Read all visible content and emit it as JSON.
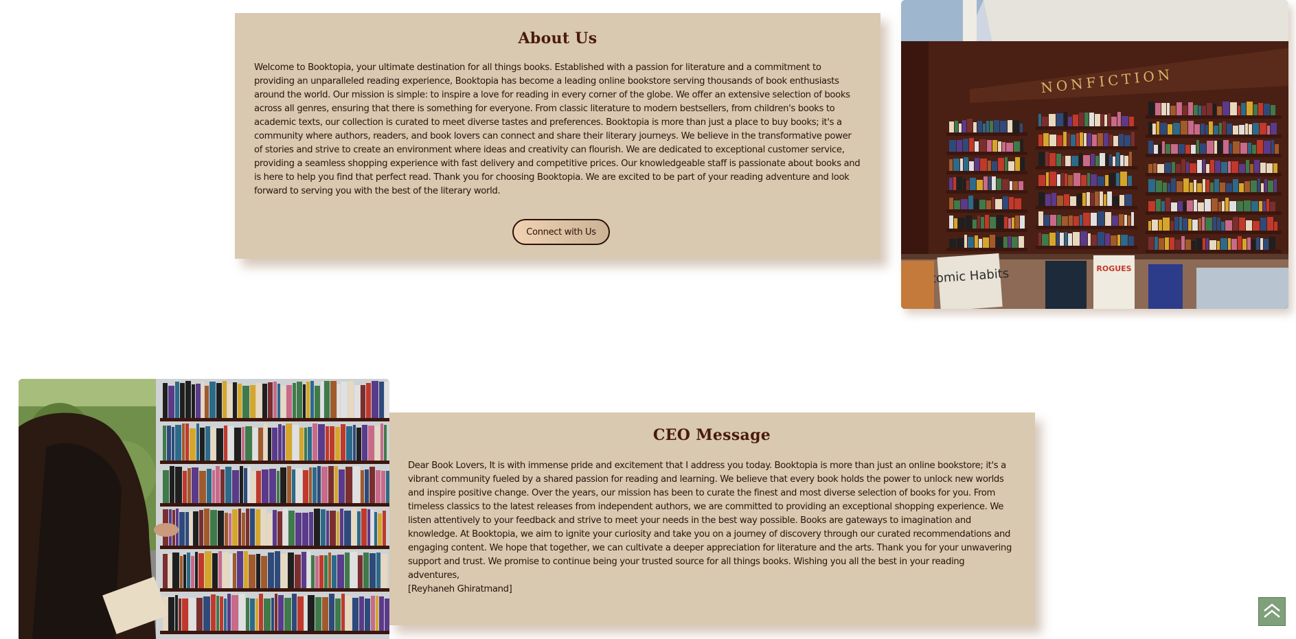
{
  "about": {
    "title": "About Us",
    "body": "Welcome to Booktopia, your ultimate destination for all things books. Established with a passion for literature and a commitment to providing an unparalleled reading experience, Booktopia has become a leading online bookstore serving thousands of book enthusiasts around the world. Our mission is simple: to inspire a love for reading in every corner of the globe. We offer an extensive selection of books across all genres, ensuring that there is something for everyone. From classic literature to modern bestsellers, from children's books to academic texts, our collection is curated to meet diverse tastes and preferences. Booktopia is more than just a place to buy books; it's a community where authors, readers, and book lovers can connect and share their literary journeys. We believe in the transformative power of stories and strive to create an environment where ideas and creativity can flourish. We are dedicated to exceptional customer service, providing a seamless shopping experience with fast delivery and competitive prices. Our knowledgeable staff is passionate about books and is here to help you find that perfect read. Thank you for choosing Booktopia. We are excited to be part of your reading adventure and look forward to serving you with the best of the literary world.",
    "button_label": "Connect with Us"
  },
  "store_photo": {
    "sign_text": "NONFICTION",
    "book_title": "Atomic Habits",
    "book2_title": "ROGUES"
  },
  "ceo": {
    "title": "CEO Message",
    "body": "Dear Book Lovers, It is with immense pride and excitement that I address you today. Booktopia is more than just an online bookstore; it's a vibrant community fueled by a shared passion for reading and learning. We believe that every book holds the power to unlock new worlds and inspire positive change. Over the years, our mission has been to curate the finest and most diverse selection of books for you. From timeless classics to the latest releases from independent authors, we are committed to providing an exceptional shopping experience. We listen attentively to your feedback and strive to meet your needs in the best way possible. Books are gateways to imagination and knowledge. At Booktopia, we aim to ignite your curiosity and take you on a journey of discovery through our curated recommendations and engaging content. We hope that together, we can cultivate a deeper appreciation for literature and the arts. Thank you for your unwavering support and trust. We promise to continue being your trusted source for all things books. Wishing you all the best in your reading adventures,",
    "signature": "[Reyhaneh Ghiratmand]"
  },
  "scroll_top": {
    "icon": "double-chevron-up-icon"
  },
  "colors": {
    "card_bg": "#d8c9b0",
    "heading": "#4a1a0e",
    "text": "#2b1208",
    "scroll_button": "#7fa07a"
  }
}
